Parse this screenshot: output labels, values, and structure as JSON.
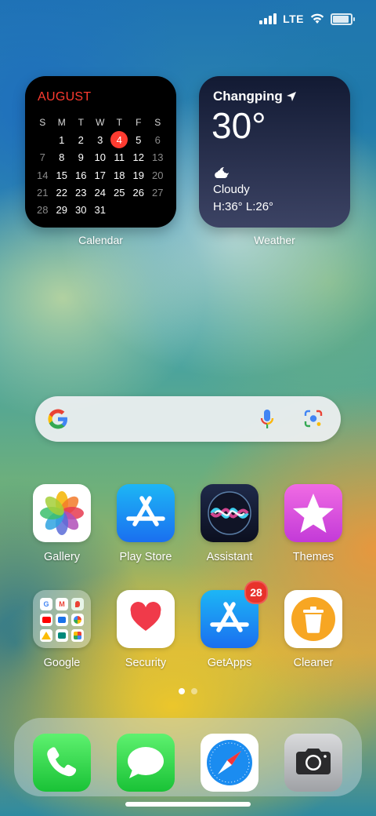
{
  "status_bar": {
    "network": "LTE",
    "signal_bars": 4,
    "battery_level_percent": 100
  },
  "calendar_widget": {
    "month": "AUGUST",
    "weekdays": [
      "S",
      "M",
      "T",
      "W",
      "T",
      "F",
      "S"
    ],
    "today": "4",
    "weeks": [
      [
        "",
        "1",
        "2",
        "3",
        "4",
        "5",
        "6"
      ],
      [
        "7",
        "8",
        "9",
        "10",
        "11",
        "12",
        "13"
      ],
      [
        "14",
        "15",
        "16",
        "17",
        "18",
        "19",
        "20"
      ],
      [
        "21",
        "22",
        "23",
        "24",
        "25",
        "26",
        "27"
      ],
      [
        "28",
        "29",
        "30",
        "31",
        "",
        "",
        ""
      ]
    ],
    "label": "Calendar"
  },
  "weather_widget": {
    "city": "Changping",
    "temperature": "30°",
    "condition": "Cloudy",
    "high_low": "H:36°  L:26°",
    "label": "Weather"
  },
  "search_bar": {
    "logo": "google-g-icon",
    "mic_icon": "microphone-icon",
    "lens_icon": "camera-lens-icon"
  },
  "apps_row1": [
    {
      "label": "Gallery",
      "icon": "gallery-icon"
    },
    {
      "label": "Play Store",
      "icon": "play-store-icon"
    },
    {
      "label": "Assistant",
      "icon": "assistant-icon"
    },
    {
      "label": "Themes",
      "icon": "themes-icon"
    }
  ],
  "apps_row2": [
    {
      "label": "Google",
      "icon": "google-folder-icon"
    },
    {
      "label": "Security",
      "icon": "security-icon"
    },
    {
      "label": "GetApps",
      "icon": "getapps-icon",
      "badge": "28"
    },
    {
      "label": "Cleaner",
      "icon": "cleaner-icon"
    }
  ],
  "page_indicator": {
    "pages": 2,
    "current": 1
  },
  "dock": [
    "phone-icon",
    "messages-icon",
    "browser-icon",
    "camera-icon"
  ],
  "colors": {
    "accent_red": "#ff3b30",
    "badge_red": "#e8322b"
  }
}
